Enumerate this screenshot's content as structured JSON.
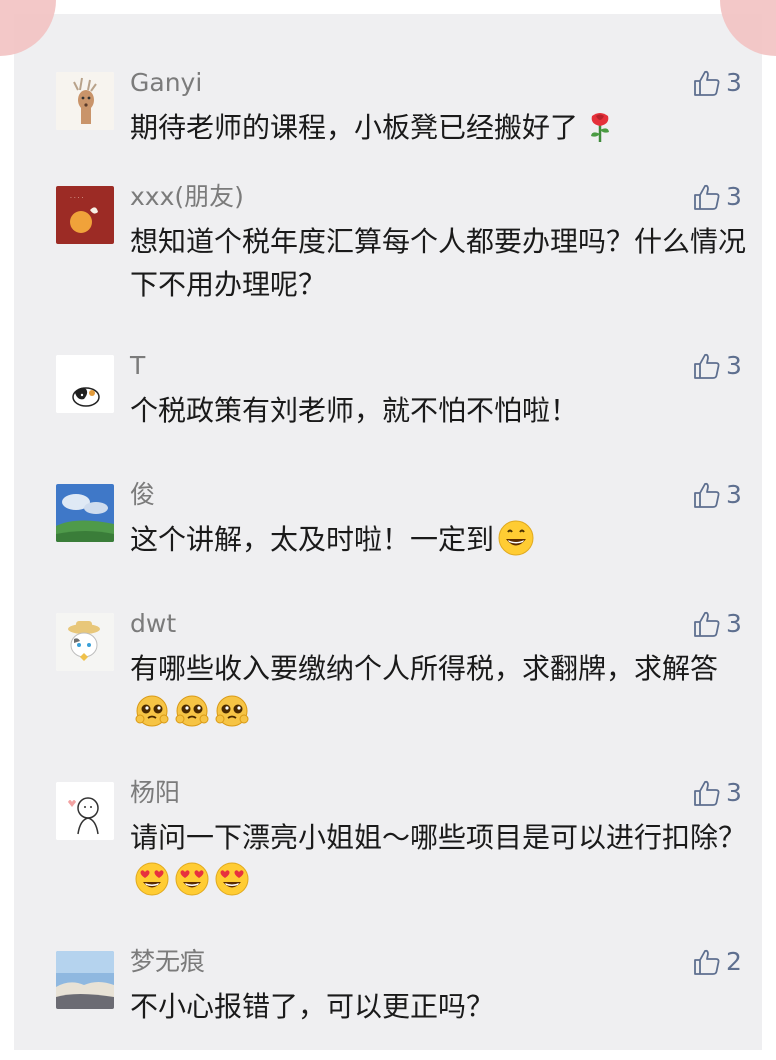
{
  "comments": [
    {
      "name": "Ganyi",
      "text": "期待老师的课程，小板凳已经搬好了",
      "likes": "3",
      "avatar_icon": "deer-avatar",
      "emoji_icons": [
        "rose-icon"
      ]
    },
    {
      "name": "xxx(朋友)",
      "text": "想知道个税年度汇算每个人都要办理吗？什么情况下不用办理呢？",
      "likes": "3",
      "avatar_icon": "orange-fruit-avatar",
      "emoji_icons": []
    },
    {
      "name": "T",
      "text": "个税政策有刘老师，就不怕不怕啦！",
      "likes": "3",
      "avatar_icon": "cat-avatar",
      "emoji_icons": []
    },
    {
      "name": "俊",
      "text": "这个讲解，太及时啦！一定到",
      "likes": "3",
      "avatar_icon": "landscape-avatar",
      "emoji_icons": [
        "grin-emoji"
      ]
    },
    {
      "name": "dwt",
      "text": "有哪些收入要缴纳个人所得税，求翻牌，求解答",
      "likes": "3",
      "avatar_icon": "cat-hat-avatar",
      "emoji_icons": [
        "pleading-emoji",
        "pleading-emoji",
        "pleading-emoji"
      ]
    },
    {
      "name": "杨阳",
      "text": "请问一下漂亮小姐姐～哪些项目是可以进行扣除？",
      "likes": "3",
      "avatar_icon": "sketch-avatar",
      "emoji_icons": [
        "heart-eyes-emoji",
        "heart-eyes-emoji",
        "heart-eyes-emoji"
      ]
    },
    {
      "name": "梦无痕",
      "text": "不小心报错了，可以更正吗？",
      "likes": "2",
      "avatar_icon": "sky-avatar",
      "emoji_icons": []
    }
  ],
  "colors": {
    "panel_bg": "#efeff1",
    "name_text": "#7b7b7b",
    "body_text": "#1a1a1a",
    "like_accent": "#5e6f8f",
    "corner_pink": "#f2c2c2"
  }
}
